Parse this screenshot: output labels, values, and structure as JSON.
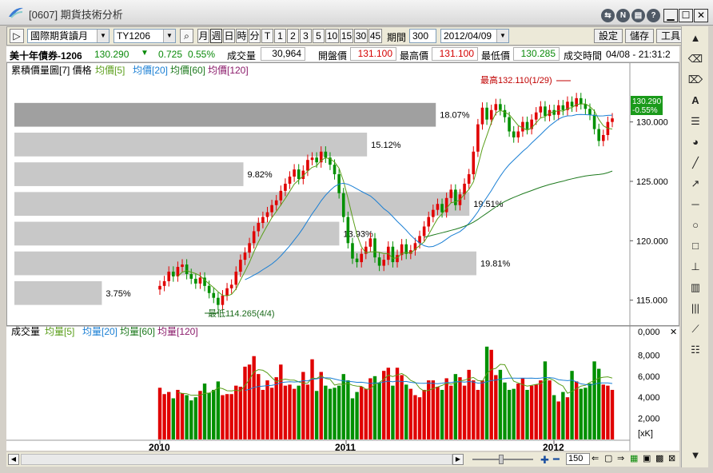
{
  "window": {
    "title": "[0607] 期貨技術分析"
  },
  "toolbar": {
    "play_icon": "play-icon",
    "category": "國際期貨讀月",
    "symbol": "TY1206",
    "periods": [
      "月",
      "週",
      "日",
      "時",
      "分",
      "T",
      "1",
      "2",
      "3",
      "5",
      "10",
      "15",
      "30",
      "45"
    ],
    "active_period": "週",
    "period_label": "期間",
    "period_value": "300",
    "date": "2012/04/09",
    "settings_label": "設定",
    "save_label": "儲存",
    "tools_label": "工具"
  },
  "quote": {
    "name": "美十年債券-1206",
    "price": "130.290",
    "change": "0.725",
    "change_pct": "0.55%",
    "volume_label": "成交量",
    "volume": "30,964",
    "open_label": "開盤價",
    "open": "131.100",
    "high_label": "最高價",
    "high": "131.100",
    "low_label": "最低價",
    "low": "130.285",
    "time_label": "成交時間",
    "time": "04/08 - 21:31:2"
  },
  "price_panel": {
    "legend_title": "累積價量圖[7] 價格",
    "ma_labels": [
      "均價[5]",
      "均價[20]",
      "均價[60]",
      "均價[120]"
    ],
    "ma_colors": [
      "#5a9e1a",
      "#1a7fd4",
      "#1e7a1e",
      "#8a1a6a"
    ],
    "high_annot": "最高132.110(1/29)",
    "low_annot": "最低114.265(4/4)",
    "price_tag": "130.290",
    "price_tag_pct": "-0.55%",
    "y_ticks": [
      "130.000",
      "125.000",
      "120.000",
      "115.000"
    ],
    "profile_pcts": [
      "18.07%",
      "15.12%",
      "9.82%",
      "19.51%",
      "13.93%",
      "19.81%",
      "3.75%"
    ]
  },
  "volume_panel": {
    "legend_title": "成交量",
    "ma_labels": [
      "均量[5]",
      "均量[20]",
      "均量[60]",
      "均量[120]"
    ],
    "y_ticks": [
      "0,000",
      "8,000",
      "6,000",
      "4,000",
      "2,000"
    ],
    "unit": "[xK]"
  },
  "x_axis": {
    "labels": [
      "2010",
      "2011",
      "2012"
    ]
  },
  "bottom_bar": {
    "zoom": "150"
  },
  "chart_data": {
    "type": "candlestick",
    "title": "累積價量圖[7] 價格",
    "x_labels": [
      "2010",
      "2011",
      "2012"
    ],
    "ylim": [
      113.5,
      133
    ],
    "ma_names": [
      "均價[5]",
      "均價[20]",
      "均價[60]",
      "均價[120]"
    ],
    "volume_profile": [
      {
        "price_low": 129.6,
        "price_high": 131.6,
        "pct": 18.07
      },
      {
        "price_low": 127.1,
        "price_high": 129.1,
        "pct": 15.12
      },
      {
        "price_low": 124.6,
        "price_high": 126.6,
        "pct": 9.82
      },
      {
        "price_low": 122.1,
        "price_high": 124.1,
        "pct": 19.51
      },
      {
        "price_low": 119.6,
        "price_high": 121.6,
        "pct": 13.93
      },
      {
        "price_low": 117.1,
        "price_high": 119.1,
        "pct": 19.81
      },
      {
        "price_low": 114.6,
        "price_high": 116.6,
        "pct": 3.75
      }
    ],
    "closes": [
      116.2,
      116.6,
      117.4,
      117.0,
      117.8,
      118.0,
      117.2,
      116.8,
      116.4,
      116.9,
      116.2,
      115.6,
      115.2,
      114.6,
      115.4,
      116.0,
      116.3,
      117.4,
      118.4,
      119.0,
      119.8,
      120.8,
      121.5,
      122.0,
      122.4,
      123.0,
      123.4,
      124.2,
      124.8,
      125.4,
      126.0,
      125.2,
      125.9,
      126.8,
      127.0,
      126.6,
      127.5,
      127.0,
      126.4,
      125.6,
      124.0,
      122.0,
      119.8,
      118.5,
      118.2,
      118.9,
      119.5,
      120.2,
      118.6,
      117.9,
      118.4,
      119.5,
      118.2,
      118.8,
      119.7,
      118.9,
      119.2,
      119.8,
      120.4,
      121.2,
      122.0,
      122.6,
      123.1,
      122.4,
      123.6,
      124.3,
      123.0,
      123.9,
      124.8,
      125.6,
      127.5,
      129.8,
      131.2,
      130.2,
      131.0,
      131.5,
      131.0,
      130.4,
      129.2,
      128.7,
      129.2,
      130.0,
      129.4,
      130.2,
      130.8,
      131.3,
      130.5,
      131.0,
      130.6,
      131.4,
      131.0,
      131.7,
      131.3,
      132.0,
      131.5,
      131.1,
      130.6,
      129.4,
      128.4,
      128.9,
      130.0,
      130.3
    ],
    "volumes": [
      4.9,
      4.3,
      4.5,
      3.9,
      4.7,
      4.4,
      4.2,
      3.7,
      4.0,
      4.6,
      5.3,
      4.4,
      4.7,
      5.5,
      4.2,
      4.3,
      4.3,
      5.1,
      5.0,
      6.9,
      7.1,
      7.9,
      6.2,
      4.7,
      5.6,
      4.9,
      5.9,
      7.1,
      5.1,
      5.2,
      4.8,
      5.1,
      6.4,
      5.2,
      7.6,
      4.6,
      6.4,
      5.1,
      4.8,
      4.9,
      5.1,
      6.2,
      5.6,
      3.9,
      4.5,
      5.0,
      4.8,
      5.8,
      6.0,
      5.4,
      6.5,
      6.8,
      5.1,
      6.8,
      6.1,
      5.2,
      4.8,
      4.2,
      4.0,
      4.7,
      5.6,
      5.6,
      5.0,
      4.7,
      5.8,
      5.1,
      6.2,
      5.9,
      5.1,
      6.6,
      5.6,
      4.7,
      5.6,
      8.8,
      8.5,
      6.1,
      6.6,
      5.4,
      4.7,
      4.8,
      5.3,
      5.8,
      4.7,
      5.1,
      5.2,
      5.6,
      7.4,
      5.6,
      4.2,
      3.6,
      4.5,
      4.0,
      6.5,
      5.5,
      4.8,
      4.9,
      5.3,
      7.4,
      6.7,
      5.2,
      5.1,
      4.7
    ]
  }
}
